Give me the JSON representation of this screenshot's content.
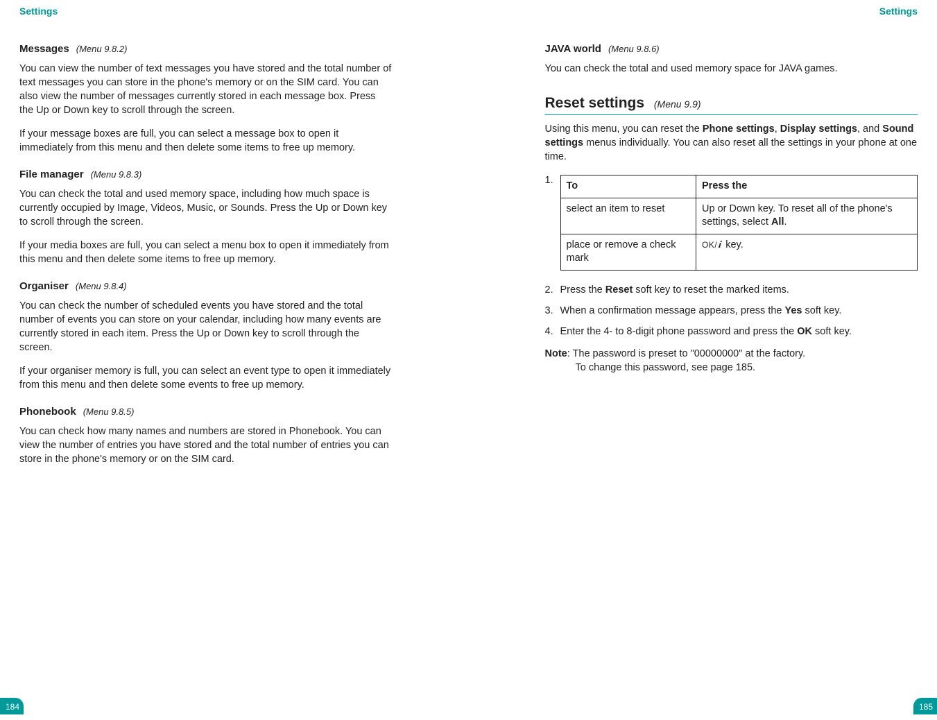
{
  "header": {
    "left": "Settings",
    "right": "Settings"
  },
  "pagenum": {
    "left": "184",
    "right": "185"
  },
  "left": {
    "messages": {
      "title": "Messages",
      "menu": "(Menu 9.8.2)",
      "p1": "You can view the number of text messages you have stored and the total number of text messages you can store in the phone's memory or on the SIM card. You can also view the number of messages currently stored in each message box. Press the Up or Down key to scroll through the screen.",
      "p2": "If your message boxes are full, you can select a message box to open it immediately from this menu and then delete some items to free up memory."
    },
    "file_manager": {
      "title": "File manager",
      "menu": "(Menu 9.8.3)",
      "p1": "You can check the total and used memory space, including how much space is currently occupied by Image, Videos, Music, or Sounds. Press the Up or Down key to scroll through the screen.",
      "p2": "If your media boxes are full, you can select a menu box to open it immediately from this menu and then delete some items to free up memory."
    },
    "organiser": {
      "title": "Organiser",
      "menu": "(Menu 9.8.4)",
      "p1": "You can check the number of scheduled events you have stored and the total number of events you can store on your calendar, including how many events are currently stored in each item. Press the Up or Down key to scroll through the screen.",
      "p2": "If your organiser memory is full, you can select an event type to open it immediately from this menu and then delete some events to free up memory."
    },
    "phonebook": {
      "title": "Phonebook",
      "menu": "(Menu 9.8.5)",
      "p1": "You can check how many names and numbers are stored in Phonebook. You can view the number of entries you have stored and the total number of entries you can store in the phone's memory or on the SIM card."
    }
  },
  "right": {
    "java": {
      "title": "JAVA world",
      "menu": "(Menu 9.8.6)",
      "p1": "You can check the total and used memory space for JAVA games."
    },
    "reset": {
      "title": "Reset settings",
      "menu": "(Menu 9.9)",
      "intro_pre": "Using this menu, you can reset the ",
      "intro_b1": "Phone settings",
      "intro_mid1": ", ",
      "intro_b2": "Display settings",
      "intro_mid2": ", and ",
      "intro_b3": "Sound settings",
      "intro_post": " menus individually. You can also reset all the settings in your phone at one time.",
      "step1_num": "1.",
      "table": {
        "h1": "To",
        "h2": "Press the",
        "r1c1": "select an item to reset",
        "r1c2_pre": "Up or Down key. To reset all of the phone's settings, select ",
        "r1c2_bold": "All",
        "r1c2_post": ".",
        "r2c1": "place or remove a check mark",
        "r2c2_ok": "OK/",
        "r2c2_post": " key."
      },
      "step2_num": "2.",
      "step2_pre": "Press the ",
      "step2_bold": "Reset",
      "step2_post": " soft key to reset the marked items.",
      "step3_num": "3.",
      "step3_pre": "When a confirmation message appears, press the ",
      "step3_bold": "Yes",
      "step3_post": " soft key.",
      "step4_num": "4.",
      "step4_pre": "Enter the 4- to 8-digit phone password and press the ",
      "step4_bold": "OK",
      "step4_post": " soft key.",
      "note_label": "Note",
      "note_sep": ": ",
      "note_line1": "The password is preset to \"00000000\" at the factory.",
      "note_line2": "To change this password, see page 185."
    }
  }
}
